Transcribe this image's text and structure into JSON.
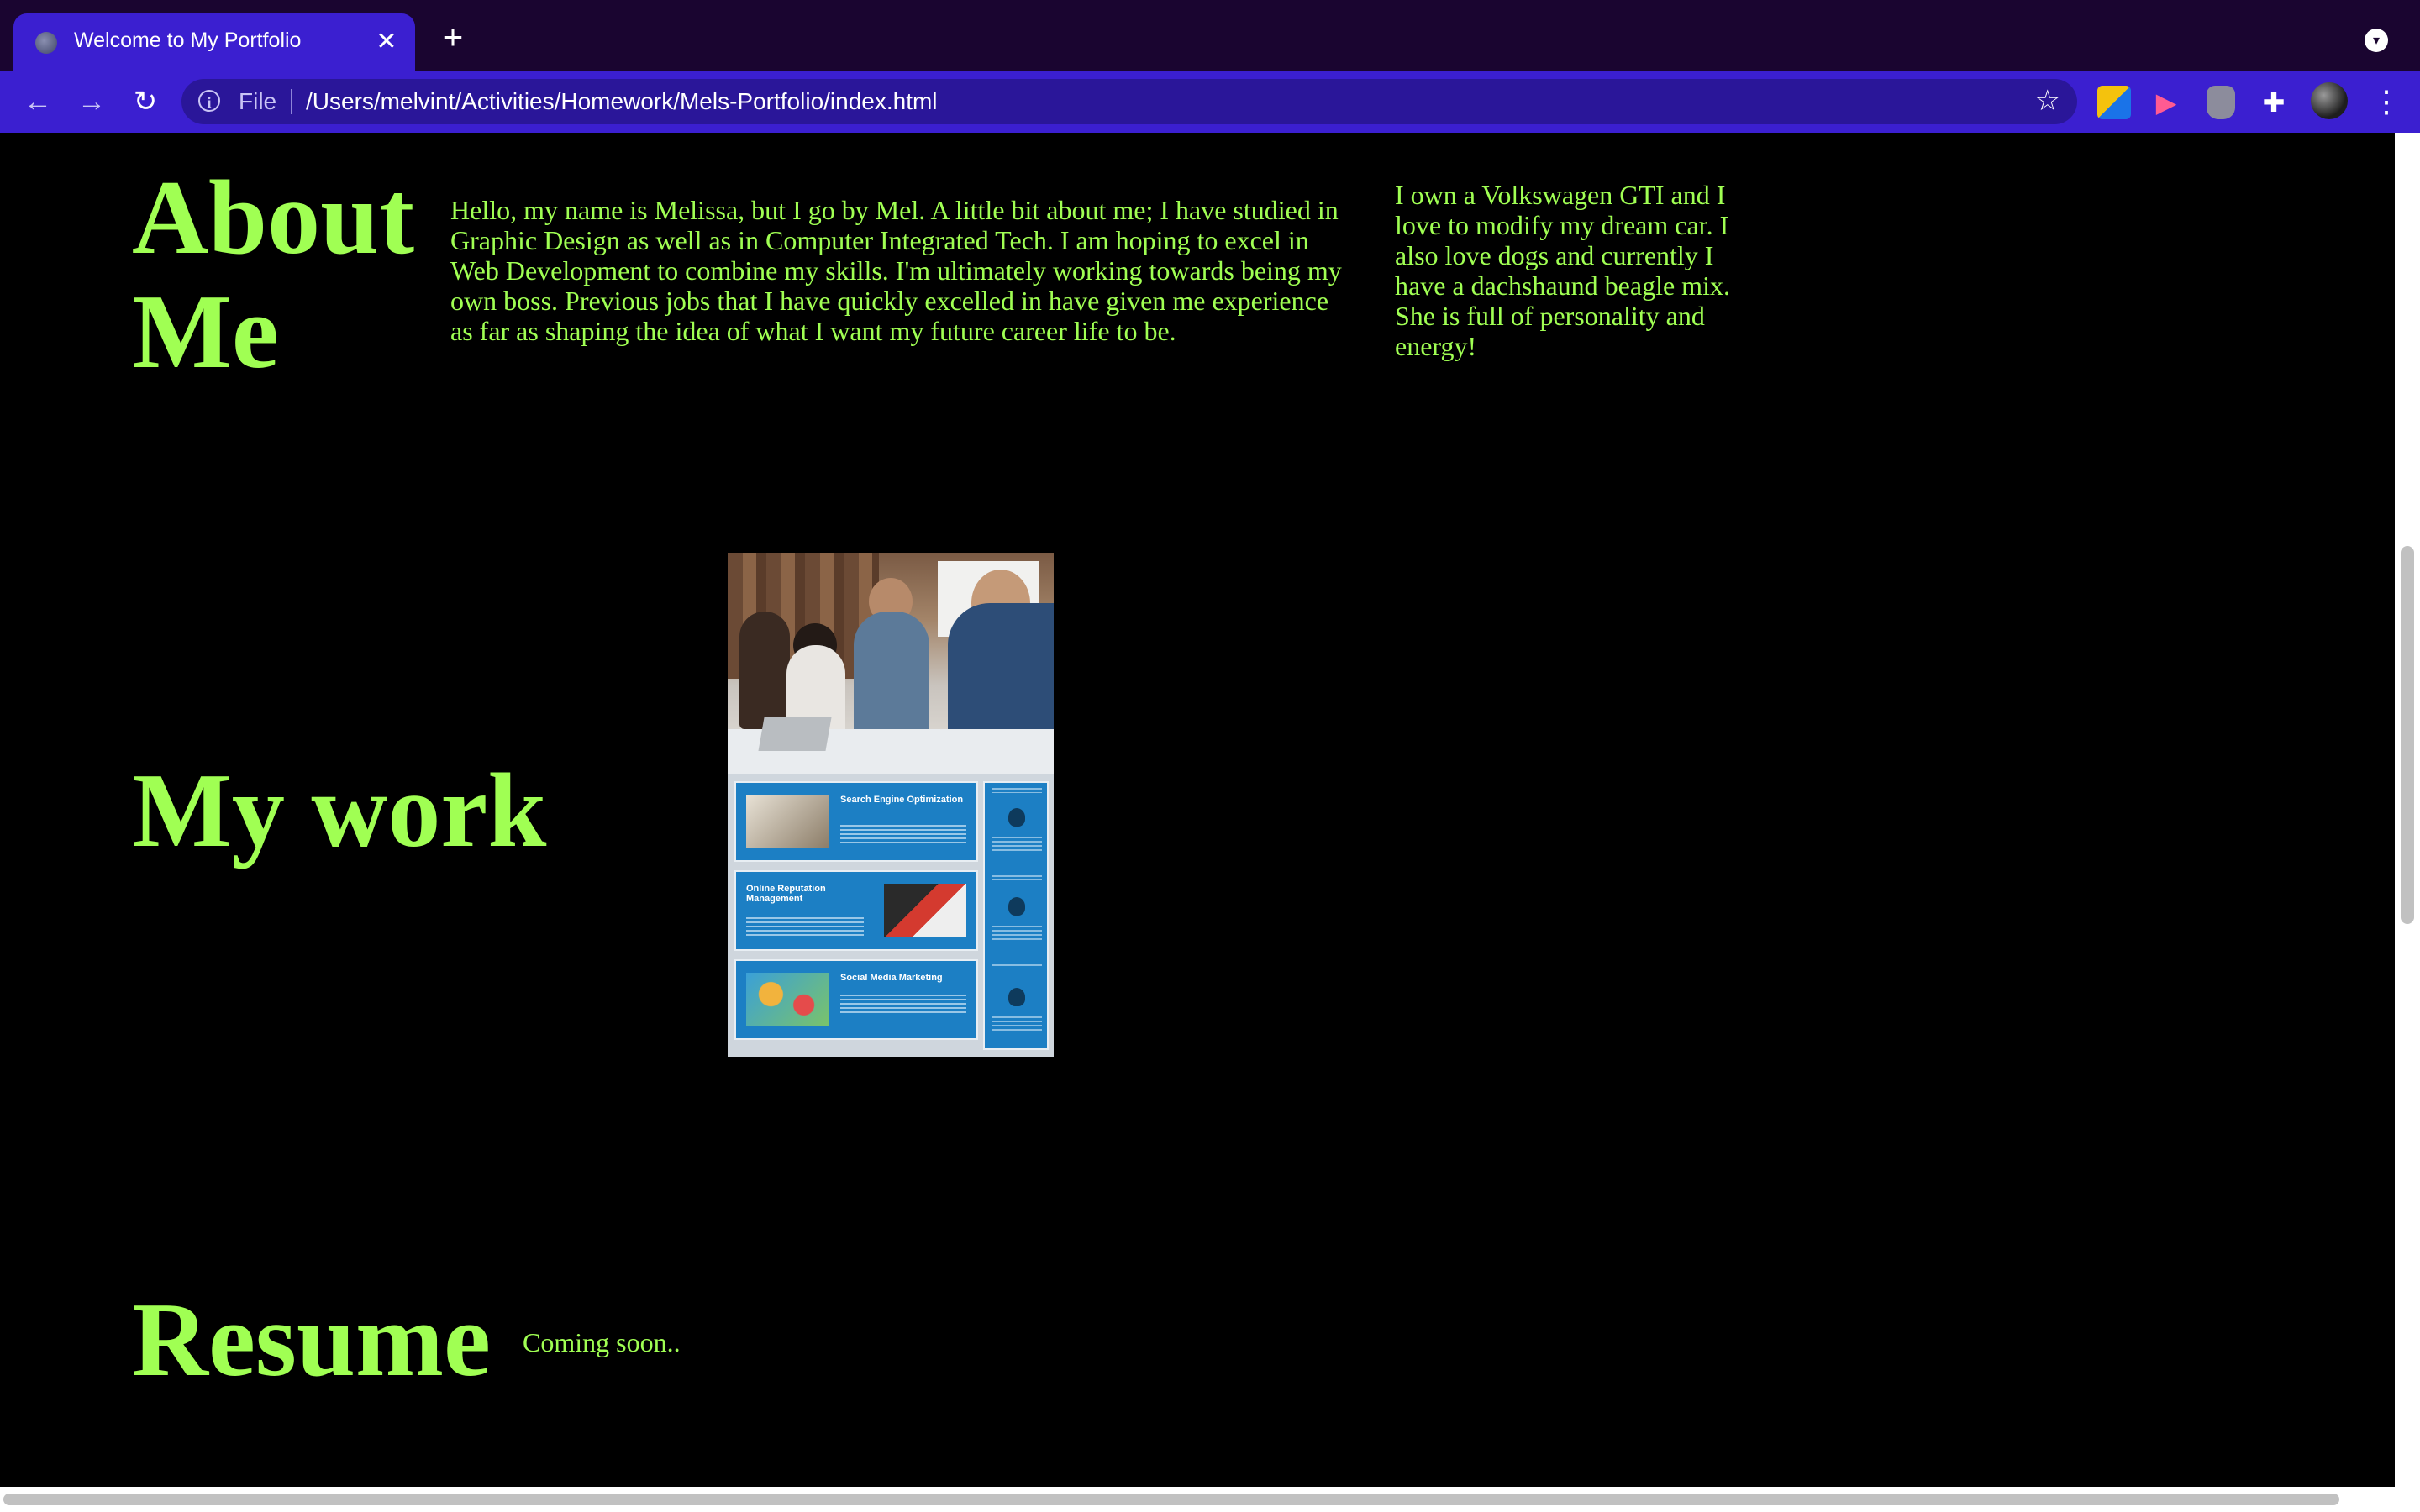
{
  "browser": {
    "tab_title": "Welcome to My Portfolio",
    "close_tab_glyph": "✕",
    "new_tab_glyph": "+",
    "url_scheme": "File",
    "url": "/Users/melvint/Activities/Homework/Mels-Portfolio/index.html",
    "icons": [
      "back-icon",
      "forward-icon",
      "reload-icon",
      "info-icon",
      "star-icon",
      "extensions-icon",
      "menu-icon"
    ]
  },
  "about": {
    "heading": "About Me",
    "paragraph1": "Hello, my name is Melissa, but I go by Mel. A little bit about me; I have studied in Graphic Design as well as in Computer Integrated Tech. I am hoping to excel in Web Development to combine my skills. I'm ultimately working towards being my own boss. Previous jobs that I have quickly excelled in have given me experience as far as shaping the idea of what I want my future career life to be.",
    "paragraph2": "I own a Volkswagen GTI and I love to modify my dream car. I also love dogs and currently I have a dachshaund beagle mix. She is full of personality and energy!"
  },
  "work": {
    "heading": "My work",
    "image": {
      "panels": [
        "Search Engine Optimization",
        "Online Reputation Management",
        "Social Media Marketing"
      ]
    }
  },
  "resume": {
    "heading": "Resume",
    "text": "Coming soon.."
  },
  "colors": {
    "page_background": "#000000",
    "text_accent": "#a0ff53",
    "browser_frame": "#3b1fd0"
  }
}
